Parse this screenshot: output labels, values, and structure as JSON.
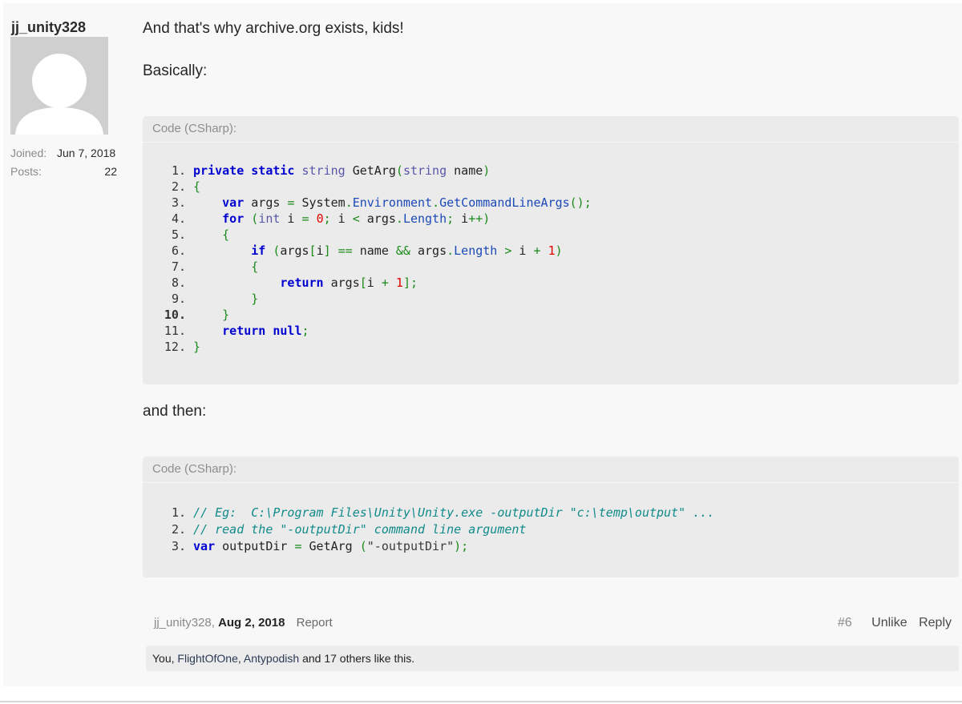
{
  "user": {
    "username": "jj_unity328",
    "joined_label": "Joined:",
    "joined_value": "Jun 7, 2018",
    "posts_label": "Posts:",
    "posts_value": "22"
  },
  "post": {
    "line1": "And that's why archive.org exists, kids!",
    "line2": "Basically:",
    "line3": "and then:"
  },
  "code1": {
    "header": "Code (CSharp):",
    "line_numbers": [
      "1.",
      "2.",
      "3.",
      "4.",
      "5.",
      "6.",
      "7.",
      "8.",
      "9.",
      "10.",
      "11.",
      "12."
    ]
  },
  "code2": {
    "header": "Code (CSharp):",
    "line_numbers": [
      "1.",
      "2.",
      "3."
    ]
  },
  "footer": {
    "author": "jj_unity328,",
    "date": "Aug 2, 2018",
    "report": "Report",
    "post_number": "#6",
    "unlike": "Unlike",
    "reply": "Reply"
  },
  "likes": {
    "prefix": "You,",
    "liker1": "FlightOfOne",
    "sep": ",",
    "liker2": "Antypodish",
    "suffix": "and 17 others like this."
  },
  "colors": {
    "keyword": "#0000d0",
    "type": "#5757a8",
    "member": "#1c49b8",
    "punctuation": "#1b8a1b",
    "number": "#e00000",
    "comment": "#108a8a"
  }
}
